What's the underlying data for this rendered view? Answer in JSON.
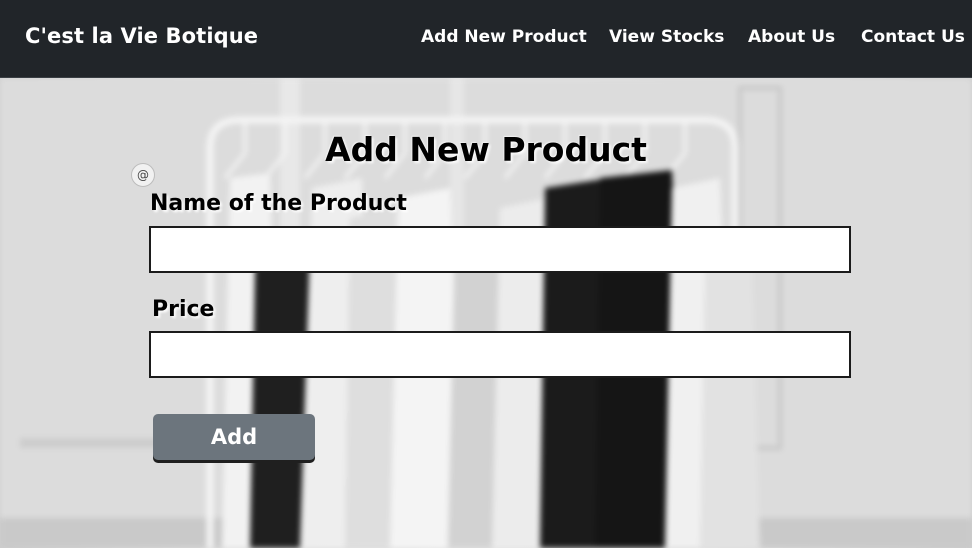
{
  "navbar": {
    "brand": "C'est la Vie Botique",
    "links": [
      "Add New Product",
      "View Stocks",
      "About Us",
      "Contact Us"
    ]
  },
  "form": {
    "title": "Add New Product",
    "badge_symbol": "@",
    "name_label": "Name of the Product",
    "name_value": "",
    "price_label": "Price",
    "price_value": "",
    "submit_label": "Add"
  },
  "colors": {
    "navbar_bg": "#212529",
    "button_bg": "#6c757d"
  }
}
